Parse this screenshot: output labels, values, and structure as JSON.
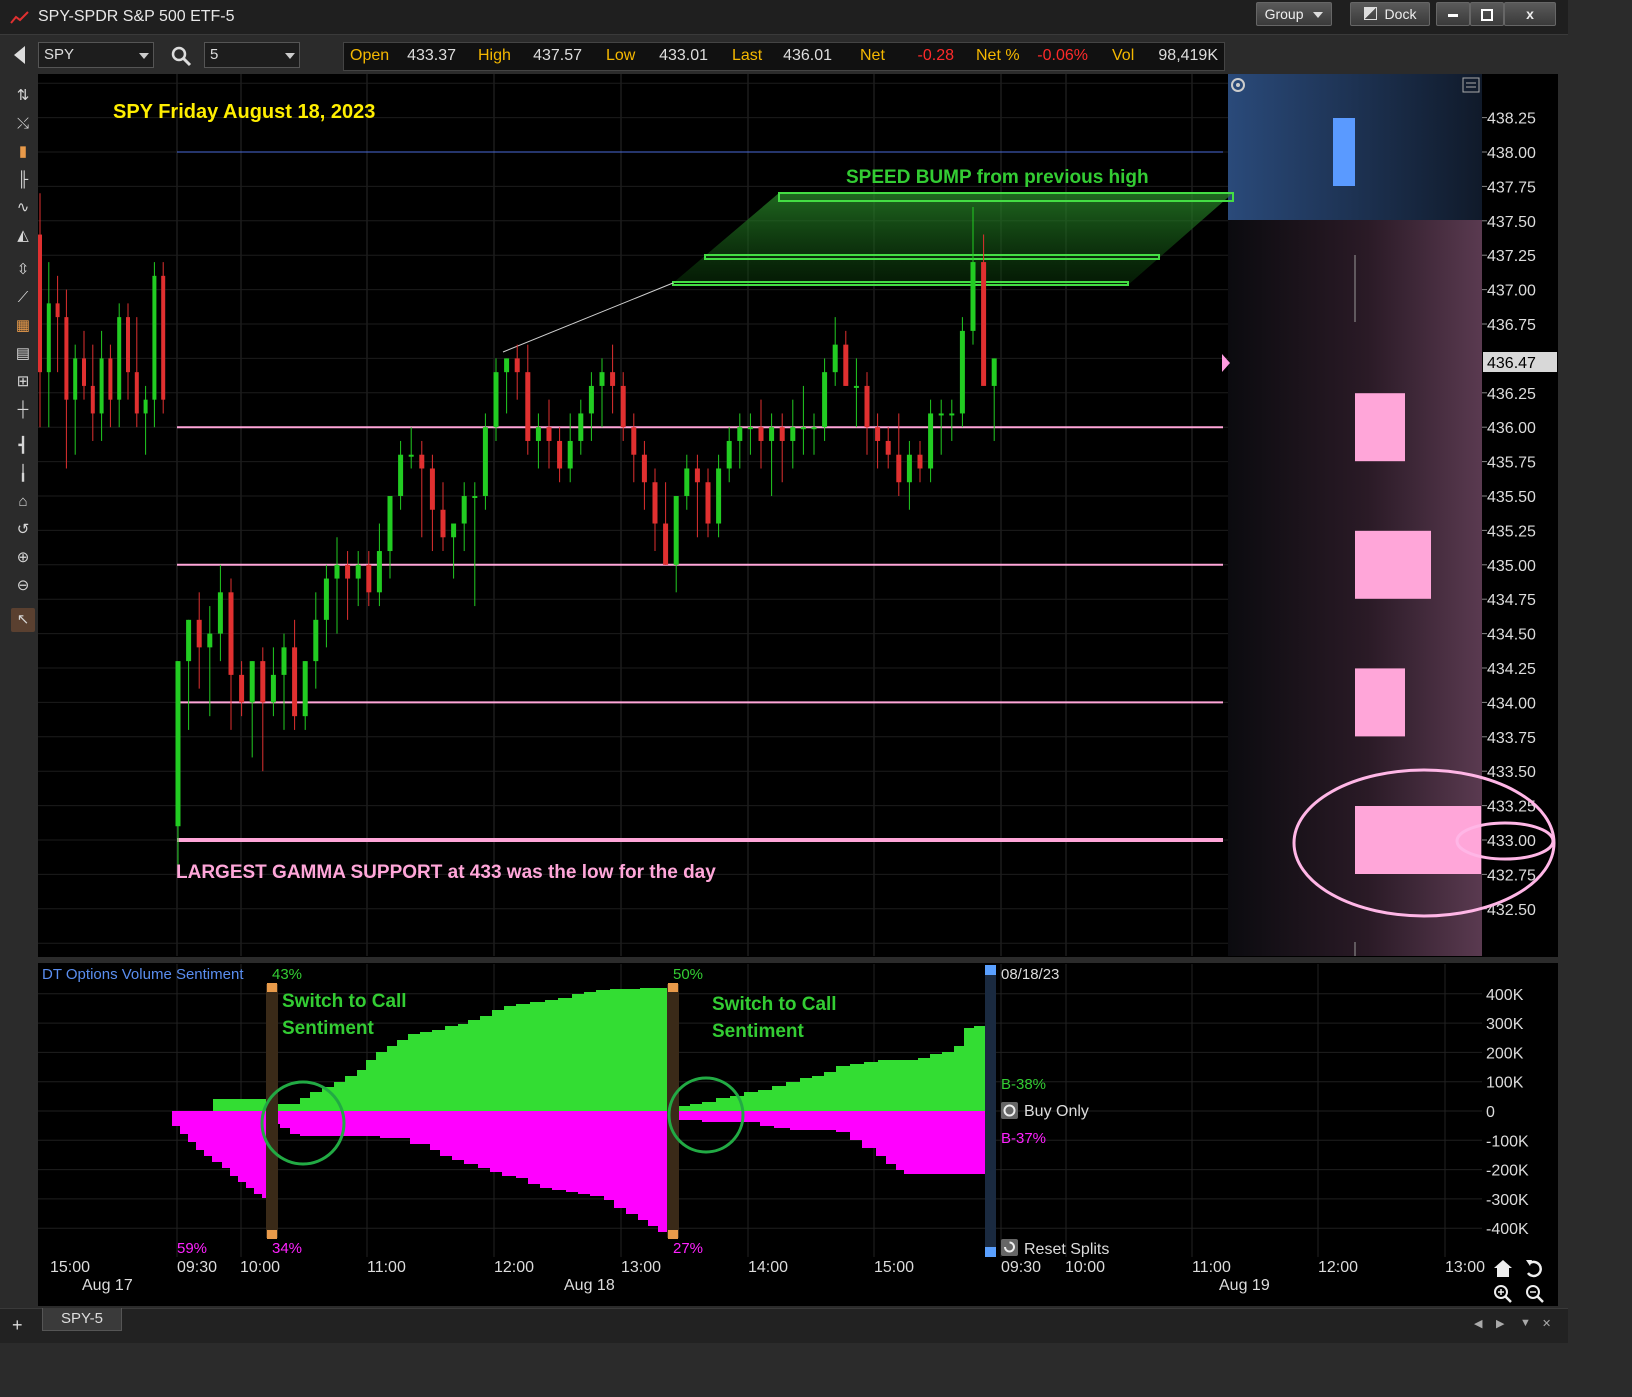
{
  "window": {
    "title": "SPY-SPDR S&P 500 ETF-5",
    "group_label": "Group",
    "dock_label": "Dock",
    "min_icon": "minimize-icon",
    "max_icon": "maximize-icon",
    "close_label": "x"
  },
  "toolbar": {
    "symbol": "SPY",
    "interval": "5",
    "quote": [
      {
        "label": "Open",
        "value": "433.37",
        "neg": false
      },
      {
        "label": "High",
        "value": "437.57",
        "neg": false
      },
      {
        "label": "Low",
        "value": "433.01",
        "neg": false
      },
      {
        "label": "Last",
        "value": "436.01",
        "neg": false
      },
      {
        "label": "Net",
        "value": "-0.28",
        "neg": true
      },
      {
        "label": "Net %",
        "value": "-0.06%",
        "neg": true
      },
      {
        "label": "Vol",
        "value": "98,419K",
        "neg": false
      }
    ]
  },
  "annotations": {
    "title": "SPY Friday August 18, 2023",
    "speed_bump": "SPEED BUMP from previous high",
    "gamma_support": "LARGEST GAMMA SUPPORT at 433 was the low for the day",
    "switch1_line1": "Switch to Call",
    "switch1_line2": "Sentiment",
    "switch2_line1": "Switch to Call",
    "switch2_line2": "Sentiment"
  },
  "price_axis": {
    "ticks": [
      "438.25",
      "438.00",
      "437.75",
      "437.50",
      "437.25",
      "437.00",
      "436.75",
      "436.25",
      "436.00",
      "435.75",
      "435.50",
      "435.25",
      "435.00",
      "434.75",
      "434.50",
      "434.25",
      "434.00",
      "433.75",
      "433.50",
      "433.25",
      "433.00",
      "432.75",
      "432.50"
    ],
    "last_price": "436.47"
  },
  "sentiment": {
    "indicator_name": "DT Options Volume Sentiment",
    "pct_call_1": "43%",
    "pct_call_2": "50%",
    "pct_put_0": "59%",
    "pct_put_1": "34%",
    "pct_put_2": "27%",
    "date": "08/18/23",
    "b_call": "B-38%",
    "b_put": "B-37%",
    "buy_only": "Buy Only",
    "reset_splits": "Reset Splits",
    "axis": [
      "400K",
      "300K",
      "200K",
      "100K",
      "0",
      "-100K",
      "-200K",
      "-300K",
      "-400K"
    ]
  },
  "time_axis": {
    "labels": [
      "15:00",
      "09:30",
      "10:00",
      "11:00",
      "12:00",
      "13:00",
      "14:00",
      "15:00",
      "09:30",
      "10:00",
      "11:00",
      "12:00",
      "13:00"
    ],
    "dates": [
      "Aug 17",
      "Aug 18",
      "Aug 19"
    ]
  },
  "tabs": {
    "active": "SPY-5"
  },
  "colors": {
    "up": "#22cc22",
    "down": "#e03030",
    "gamma_pink": "#ffa6d9",
    "call_green": "#33dd33",
    "put_magenta": "#ff00ff",
    "annot_yellow": "#ffee00",
    "annot_green": "#33cc33"
  },
  "chart_data": {
    "type": "candlestick",
    "title": "SPY Friday August 18, 2023",
    "y_range": [
      432.4,
      438.4
    ],
    "gamma_levels": [
      433.0,
      434.0,
      435.0,
      436.0
    ],
    "gamma_bars": [
      {
        "price": 436.0,
        "strength": 0.4
      },
      {
        "price": 435.0,
        "strength": 0.6
      },
      {
        "price": 434.0,
        "strength": 0.4
      },
      {
        "price": 433.0,
        "strength": 1.0
      },
      {
        "price": 438.0,
        "strength": 0.17
      }
    ],
    "prev_day_candles": [
      [
        437.4,
        437.7,
        436.0,
        436.4
      ],
      [
        436.4,
        437.2,
        436.0,
        436.9
      ],
      [
        436.9,
        437.1,
        436.4,
        436.8
      ],
      [
        436.8,
        437.0,
        435.7,
        436.2
      ],
      [
        436.2,
        436.6,
        435.8,
        436.5
      ],
      [
        436.5,
        436.7,
        436.2,
        436.3
      ],
      [
        436.3,
        436.6,
        435.9,
        436.1
      ],
      [
        436.1,
        436.7,
        435.9,
        436.5
      ],
      [
        436.5,
        436.6,
        436.0,
        436.2
      ],
      [
        436.2,
        436.9,
        436.0,
        436.8
      ],
      [
        436.8,
        436.9,
        436.2,
        436.4
      ],
      [
        436.4,
        436.8,
        436.0,
        436.1
      ],
      [
        436.1,
        436.3,
        435.8,
        436.2
      ],
      [
        436.2,
        437.2,
        436.0,
        437.1
      ],
      [
        437.1,
        437.2,
        436.1,
        436.2
      ]
    ],
    "day_candles": [
      [
        433.1,
        434.3,
        432.8,
        434.3
      ],
      [
        434.3,
        434.6,
        433.8,
        434.6
      ],
      [
        434.6,
        434.8,
        434.1,
        434.4
      ],
      [
        434.4,
        434.7,
        433.9,
        434.5
      ],
      [
        434.5,
        435.0,
        434.3,
        434.8
      ],
      [
        434.8,
        434.9,
        433.8,
        434.2
      ],
      [
        434.2,
        434.3,
        433.9,
        434.0
      ],
      [
        434.0,
        434.3,
        433.6,
        434.3
      ],
      [
        434.3,
        434.4,
        433.5,
        434.0
      ],
      [
        434.0,
        434.4,
        433.9,
        434.2
      ],
      [
        434.2,
        434.5,
        433.8,
        434.4
      ],
      [
        434.4,
        434.6,
        433.8,
        433.9
      ],
      [
        433.9,
        434.3,
        433.8,
        434.3
      ],
      [
        434.3,
        434.8,
        434.1,
        434.6
      ],
      [
        434.6,
        435.0,
        434.4,
        434.9
      ],
      [
        434.9,
        435.2,
        434.5,
        435.0
      ],
      [
        435.0,
        435.1,
        434.6,
        434.9
      ],
      [
        434.9,
        435.1,
        434.7,
        435.0
      ],
      [
        435.0,
        435.1,
        434.7,
        434.8
      ],
      [
        434.8,
        435.3,
        434.7,
        435.1
      ],
      [
        435.1,
        435.3,
        434.9,
        435.5
      ],
      [
        435.5,
        435.9,
        435.4,
        435.8
      ],
      [
        435.8,
        436.0,
        435.7,
        435.8
      ],
      [
        435.8,
        435.9,
        435.2,
        435.7
      ],
      [
        435.7,
        435.8,
        435.1,
        435.4
      ],
      [
        435.4,
        435.6,
        435.1,
        435.2
      ],
      [
        435.2,
        435.3,
        434.9,
        435.3
      ],
      [
        435.3,
        435.6,
        435.1,
        435.5
      ],
      [
        435.5,
        435.6,
        434.7,
        435.5
      ],
      [
        435.5,
        436.1,
        435.4,
        436.0
      ],
      [
        436.0,
        436.5,
        435.9,
        436.4
      ],
      [
        436.4,
        436.5,
        436.1,
        436.5
      ],
      [
        436.5,
        436.6,
        436.2,
        436.4
      ],
      [
        436.4,
        436.6,
        435.8,
        435.9
      ],
      [
        435.9,
        436.1,
        435.7,
        436.0
      ],
      [
        436.0,
        436.2,
        435.7,
        435.9
      ],
      [
        435.9,
        436.0,
        435.6,
        435.7
      ],
      [
        435.7,
        436.1,
        435.6,
        435.9
      ],
      [
        435.9,
        436.2,
        435.8,
        436.1
      ],
      [
        436.1,
        436.4,
        435.9,
        436.3
      ],
      [
        436.3,
        436.5,
        436.0,
        436.4
      ],
      [
        436.4,
        436.6,
        436.1,
        436.3
      ],
      [
        436.3,
        436.4,
        435.9,
        436.0
      ],
      [
        436.0,
        436.1,
        435.6,
        435.8
      ],
      [
        435.8,
        435.9,
        435.4,
        435.6
      ],
      [
        435.6,
        435.7,
        435.1,
        435.3
      ],
      [
        435.3,
        435.6,
        435.0,
        435.0
      ],
      [
        435.0,
        435.5,
        434.8,
        435.5
      ],
      [
        435.5,
        435.8,
        435.4,
        435.7
      ],
      [
        435.7,
        435.8,
        435.2,
        435.6
      ],
      [
        435.6,
        435.7,
        435.2,
        435.3
      ],
      [
        435.3,
        435.8,
        435.2,
        435.7
      ],
      [
        435.7,
        436.0,
        435.6,
        435.9
      ],
      [
        435.9,
        436.1,
        435.7,
        436.0
      ],
      [
        436.0,
        436.1,
        435.8,
        436.0
      ],
      [
        436.0,
        436.2,
        435.7,
        435.9
      ],
      [
        435.9,
        436.1,
        435.5,
        436.0
      ],
      [
        436.0,
        436.1,
        435.6,
        435.9
      ],
      [
        435.9,
        436.2,
        435.7,
        436.0
      ],
      [
        436.0,
        436.3,
        435.8,
        436.0
      ],
      [
        436.0,
        436.1,
        435.8,
        436.0
      ],
      [
        436.0,
        436.5,
        435.9,
        436.4
      ],
      [
        436.4,
        436.8,
        436.3,
        436.6
      ],
      [
        436.6,
        436.7,
        436.3,
        436.3
      ],
      [
        436.3,
        436.5,
        436.0,
        436.3
      ],
      [
        436.3,
        436.4,
        435.8,
        436.0
      ],
      [
        436.0,
        436.1,
        435.7,
        435.9
      ],
      [
        435.9,
        436.0,
        435.7,
        435.8
      ],
      [
        435.8,
        436.1,
        435.5,
        435.6
      ],
      [
        435.6,
        435.9,
        435.4,
        435.8
      ],
      [
        435.8,
        435.9,
        435.6,
        435.7
      ],
      [
        435.7,
        436.2,
        435.6,
        436.1
      ],
      [
        436.1,
        436.2,
        435.8,
        436.1
      ],
      [
        436.1,
        436.2,
        435.9,
        436.1
      ],
      [
        436.1,
        436.8,
        436.0,
        436.7
      ],
      [
        436.7,
        437.6,
        436.6,
        437.2
      ],
      [
        437.2,
        437.4,
        436.3,
        436.3
      ],
      [
        436.3,
        436.5,
        435.9,
        436.5
      ]
    ]
  }
}
